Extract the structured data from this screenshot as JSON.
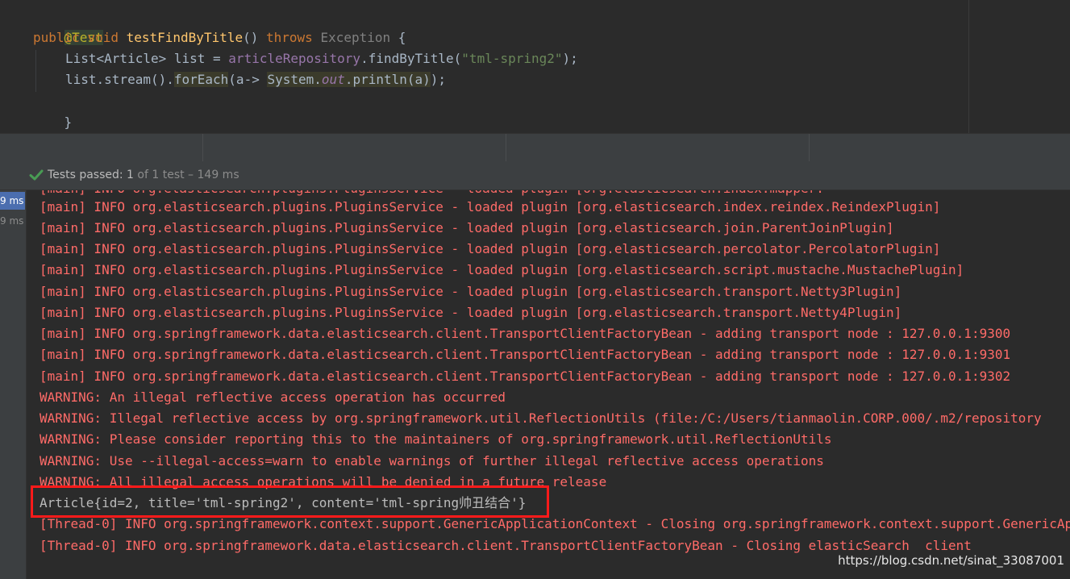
{
  "editor": {
    "annotation": "@Test",
    "line2": {
      "kw_public": "public",
      "kw_void": "void",
      "method": "testFindByTitle",
      "parens": "() ",
      "kw_throws": "throws",
      "exception": "Exception",
      "brace": " {"
    },
    "line3": {
      "decl": "List<Article> list = ",
      "repo": "articleRepository",
      "call": ".findByTitle(",
      "arg": "\"tml-spring2\"",
      "end": ");"
    },
    "line4": {
      "start": "list.stream().",
      "foreach": "forEach",
      "lambda": "(a-> ",
      "system": "System.",
      "out": "out",
      "println": ".println(a)",
      "end": ");"
    },
    "close": "}"
  },
  "status": {
    "label": "Tests passed: ",
    "passed": "1",
    "rest": " of 1 test – 149 ms"
  },
  "tree": {
    "times": [
      "9 ms",
      "9 ms"
    ]
  },
  "console": {
    "partial_top": "[main] INFO org.elasticsearch.plugins.PluginsService - loaded plugin [org.elasticsearch.index.mapper.",
    "lines": [
      "[main] INFO org.elasticsearch.plugins.PluginsService - loaded plugin [org.elasticsearch.index.reindex.ReindexPlugin]",
      "[main] INFO org.elasticsearch.plugins.PluginsService - loaded plugin [org.elasticsearch.join.ParentJoinPlugin]",
      "[main] INFO org.elasticsearch.plugins.PluginsService - loaded plugin [org.elasticsearch.percolator.PercolatorPlugin]",
      "[main] INFO org.elasticsearch.plugins.PluginsService - loaded plugin [org.elasticsearch.script.mustache.MustachePlugin]",
      "[main] INFO org.elasticsearch.plugins.PluginsService - loaded plugin [org.elasticsearch.transport.Netty3Plugin]",
      "[main] INFO org.elasticsearch.plugins.PluginsService - loaded plugin [org.elasticsearch.transport.Netty4Plugin]",
      "[main] INFO org.springframework.data.elasticsearch.client.TransportClientFactoryBean - adding transport node : 127.0.0.1:9300",
      "[main] INFO org.springframework.data.elasticsearch.client.TransportClientFactoryBean - adding transport node : 127.0.0.1:9301",
      "[main] INFO org.springframework.data.elasticsearch.client.TransportClientFactoryBean - adding transport node : 127.0.0.1:9302",
      "WARNING: An illegal reflective access operation has occurred",
      "WARNING: Illegal reflective access by org.springframework.util.ReflectionUtils (file:/C:/Users/tianmaolin.CORP.000/.m2/repository",
      "WARNING: Please consider reporting this to the maintainers of org.springframework.util.ReflectionUtils",
      "WARNING: Use --illegal-access=warn to enable warnings of further illegal reflective access operations",
      "WARNING: All illegal access operations will be denied in a future release",
      "Article{id=2, title='tml-spring2', content='tml-spring帅丑结合'}",
      "[Thread-0] INFO org.springframework.context.support.GenericApplicationContext - Closing org.springframework.context.support.GenericApplicationContext",
      "[Thread-0] INFO org.springframework.data.elasticsearch.client.TransportClientFactoryBean - Closing elasticSearch  client"
    ]
  },
  "watermark": "https://blog.csdn.net/sinat_33087001",
  "colors": {
    "error_text": "#ff6b68",
    "stdout_text": "#bbbbbb",
    "highlight_box": "#ff1a1a",
    "check_green": "#499c54"
  }
}
